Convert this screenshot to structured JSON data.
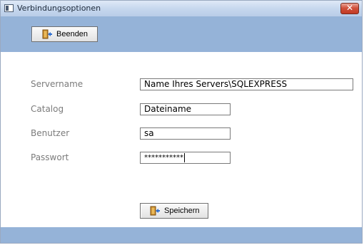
{
  "window": {
    "title": "Verbindungsoptionen",
    "close_glyph": "✕"
  },
  "toolbar": {
    "quit_label": "Beenden",
    "quit_icon": "exit-door-icon"
  },
  "form": {
    "server_label": "Servername",
    "server_value": "Name Ihres Servers\\SQLEXPRESS",
    "catalog_label": "Catalog",
    "catalog_value": "Dateiname",
    "user_label": "Benutzer",
    "user_value": "sa",
    "password_label": "Passwort",
    "password_value": "***********"
  },
  "footer": {
    "save_label": "Speichern",
    "save_icon": "exit-door-icon"
  },
  "colors": {
    "band": "#95b3d8",
    "close": "#c23a24",
    "label": "#7b7b7b"
  }
}
